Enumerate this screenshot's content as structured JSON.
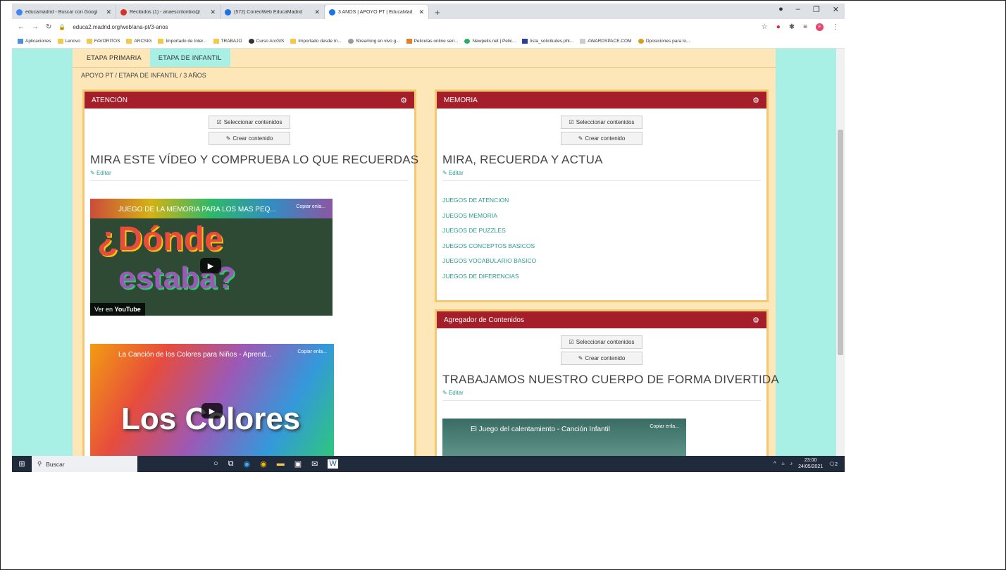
{
  "browser": {
    "tabs": [
      {
        "label": "educamadrid - Buscar con Googl",
        "color": "#4285f4"
      },
      {
        "label": "Recibidos (1) - anaescritoribio@",
        "color": "#d93025"
      },
      {
        "label": "(572) CorreoWeb EducaMadrid",
        "color": "#1a73e8"
      },
      {
        "label": "3 AÑOS | APOYO PT | EducaMad",
        "color": "#1a73e8"
      }
    ],
    "new_tab": "+",
    "url": "educa2.madrid.org/web/ana-pt/3-anos",
    "avatar_letter": "F",
    "bookmarks": [
      "Aplicaciones",
      "Lenovo",
      "FAVORITOS",
      "ARCSIG",
      "Importado de Inter...",
      "TRABAJO",
      "Curso ArcGIS",
      "Importado desde In...",
      "Streaming en vivo g...",
      "Peliculas online seri...",
      "Newpelis.net | Pelic...",
      "lista_solicitudes.pht...",
      "AWARDSPACE.COM",
      "Oposiciones para lo..."
    ]
  },
  "page": {
    "etapas": [
      "ETAPA PRIMARIA",
      "ETAPA DE INFANTIL"
    ],
    "breadcrumb": "APOYO PT / ETAPA DE INFANTIL / 3 AÑOS",
    "btn_select": "Seleccionar contenidos",
    "btn_create": "Crear contenido",
    "editar": "Editar",
    "atencion": {
      "header": "ATENCIÓN",
      "title": "MIRA ESTE VÍDEO Y COMPRUEBA LO QUE RECUERDAS",
      "video1": {
        "title": "JUEGO DE LA MEMORIA PARA LOS MAS PEQ...",
        "copy": "Copiar enla...",
        "big1": "¿Dónde",
        "big2": "estaba?",
        "ver_en": "Ver en",
        "youtube": "YouTube"
      },
      "video2": {
        "title": "La Canción de los Colores para Niños - Aprend...",
        "copy": "Copiar enla...",
        "big": "Los Colores"
      }
    },
    "memoria": {
      "header": "MEMORIA",
      "title": "MIRA, RECUERDA Y ACTUA",
      "links": [
        "JUEGOS DE ATENCION",
        "JUEGOS MEMORIA",
        "JUEGOS DE PUZZLES",
        "JUEGOS CONCEPTOS BASICOS",
        "JUEGOS VOCABULARIO BASICO",
        "JUEGOS DE DIFERENCIAS"
      ]
    },
    "agregador": {
      "header": "Agregador de Contenidos",
      "title": "TRABAJAMOS NUESTRO CUERPO DE FORMA DIVERTIDA",
      "video": {
        "title": "El Juego del calentamiento - Canción Infantil",
        "copy": "Copiar enla..."
      }
    }
  },
  "taskbar": {
    "search": "Buscar",
    "time": "23:00",
    "date": "24/05/2021",
    "notif": "2"
  }
}
